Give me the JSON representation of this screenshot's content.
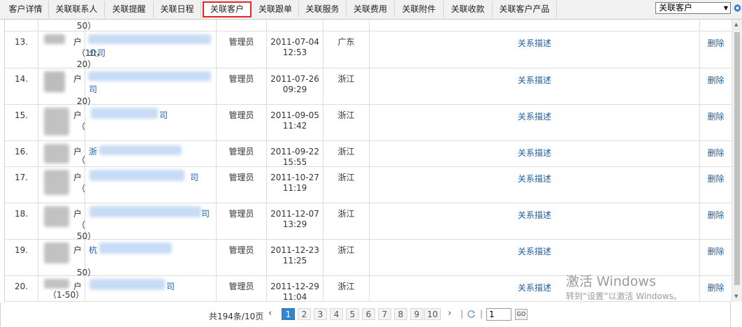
{
  "tabs": [
    {
      "label": "客户详情",
      "active": false
    },
    {
      "label": "关联联系人",
      "active": false
    },
    {
      "label": "关联提醒",
      "active": false
    },
    {
      "label": "关联日程",
      "active": false
    },
    {
      "label": "关联客户",
      "active": true
    },
    {
      "label": "关联跟单",
      "active": false
    },
    {
      "label": "关联服务",
      "active": false
    },
    {
      "label": "关联费用",
      "active": false
    },
    {
      "label": "关联附件",
      "active": false
    },
    {
      "label": "关联收款",
      "active": false
    },
    {
      "label": "关联客户产品",
      "active": false
    }
  ],
  "select": {
    "value": "关联客户"
  },
  "icons": {
    "settings": "gear-icon",
    "scroll_up": "arrow-up-icon",
    "scroll_down": "arrow-down-icon",
    "refresh": "refresh-icon"
  },
  "colors": {
    "active_tab_border": "#e8242b",
    "link": "#1c5ea5",
    "active_page": "#2f87d0"
  },
  "top_fragment": {
    "text": "50）"
  },
  "rows": [
    {
      "num": "13.",
      "type": "户",
      "sub": "（10，",
      "sub2": "20）",
      "name": "公司",
      "creator": "管理员",
      "date": "2011-07-04",
      "time": "12:53",
      "region": "广东",
      "desc": "关系描述",
      "action": "删除"
    },
    {
      "num": "14.",
      "type": "户",
      "sub": "",
      "sub2": "20）",
      "name": "司",
      "creator": "管理员",
      "date": "2011-07-26",
      "time": "09:29",
      "region": "浙江",
      "desc": "关系描述",
      "action": "删除"
    },
    {
      "num": "15.",
      "type": "户",
      "sub": "（",
      "sub2": "",
      "name": "司",
      "creator": "管理员",
      "date": "2011-09-05",
      "time": "11:42",
      "region": "浙江",
      "desc": "关系描述",
      "action": "删除"
    },
    {
      "num": "16.",
      "type": "户",
      "sub": "（",
      "sub2": "",
      "name": "浙",
      "creator": "管理员",
      "date": "2011-09-22",
      "time": "15:55",
      "region": "浙江",
      "desc": "关系描述",
      "action": "删除"
    },
    {
      "num": "17.",
      "type": "户",
      "sub": "（",
      "sub2": "",
      "name": "司",
      "creator": "管理员",
      "date": "2011-10-27",
      "time": "11:19",
      "region": "浙江",
      "desc": "关系描述",
      "action": "删除"
    },
    {
      "num": "18.",
      "type": "户",
      "sub": "（",
      "sub2": "50）",
      "name": "司",
      "creator": "管理员",
      "date": "2011-12-07",
      "time": "13:29",
      "region": "浙江",
      "desc": "关系描述",
      "action": "删除"
    },
    {
      "num": "19.",
      "type": "户",
      "sub": "",
      "sub2": "50）",
      "name": "杭",
      "creator": "管理员",
      "date": "2011-12-23",
      "time": "11:25",
      "region": "浙江",
      "desc": "关系描述",
      "action": "删除"
    },
    {
      "num": "20.",
      "type": "户",
      "sub": "（1-50）",
      "sub2": "",
      "name": "司",
      "creator": "管理员",
      "date": "2011-12-29",
      "time": "11:04",
      "region": "浙江",
      "desc": "关系描述",
      "action": "删除"
    }
  ],
  "pager": {
    "total": "共194条/10页",
    "prev": "‹",
    "next": "›",
    "pages": [
      "1",
      "2",
      "3",
      "4",
      "5",
      "6",
      "7",
      "8",
      "9",
      "10"
    ],
    "current": "1",
    "input_value": "1",
    "go": "GO"
  },
  "watermark": {
    "line1": "激活 Windows",
    "line2": "转到“设置”以激活 Windows。"
  }
}
